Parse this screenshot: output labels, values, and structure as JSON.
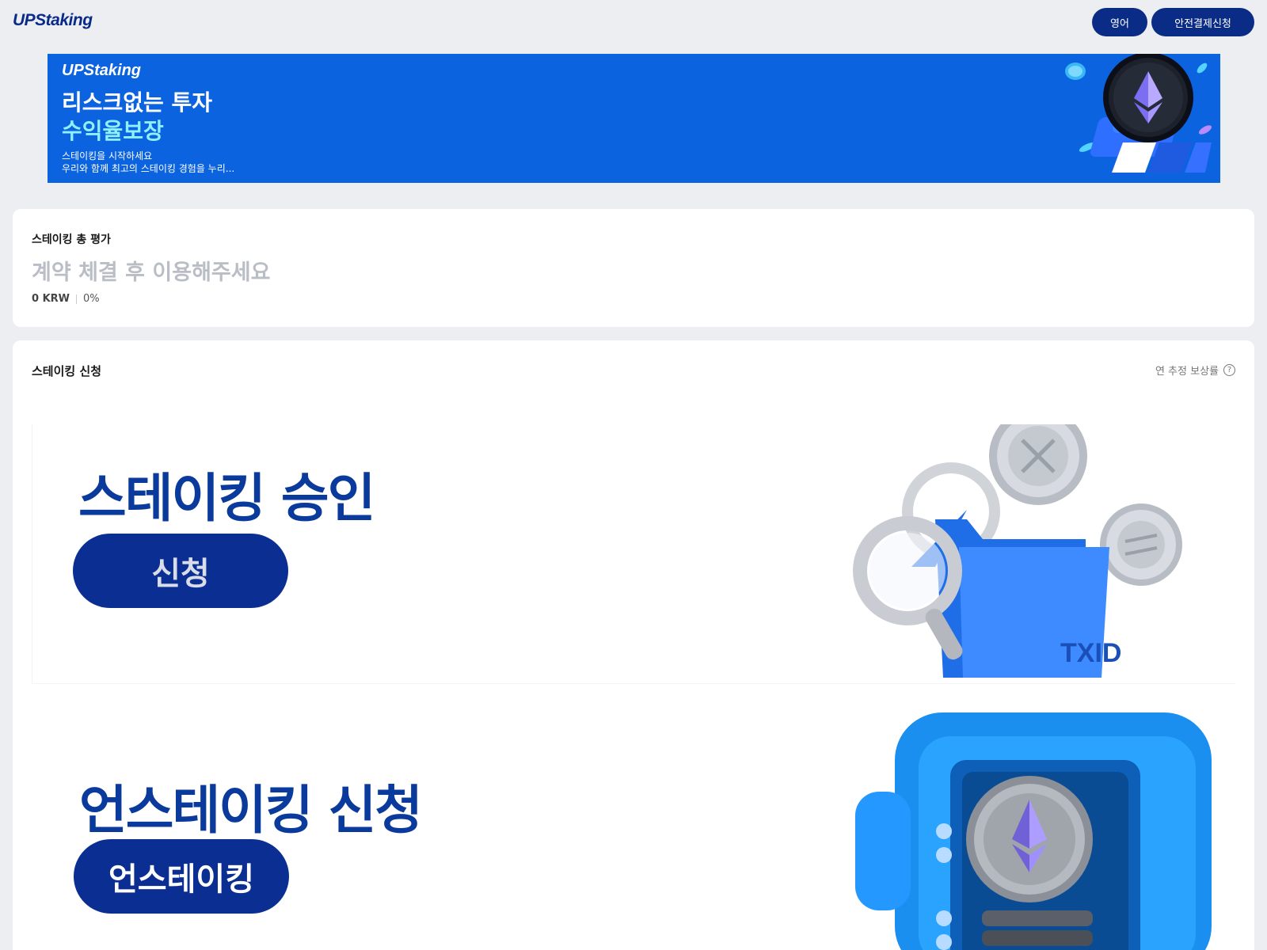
{
  "header": {
    "logo": "UPStaking",
    "lang_label": "영어",
    "payment_label": "안전결제신청"
  },
  "banner": {
    "logo": "UPStaking",
    "headline": "리스크없는 투자",
    "headline_accent": "수익율보장",
    "sub1": "스테이킹을 시작하세요",
    "sub2": "우리와 함께 최고의 스테이킹 경험을 누리...",
    "accent_color": "#8ff0ff",
    "bg_color": "#0b63e0"
  },
  "summary": {
    "title": "스테이킹 총 평가",
    "message": "계약 체결 후 이용해주세요",
    "amount": "0 KRW",
    "percent": "0%"
  },
  "staking": {
    "title": "스테이킹 신청",
    "yield_label": "연 추정 보상률",
    "help_glyph": "?",
    "promos": [
      {
        "title": "스테이킹  승인",
        "button": "신청",
        "art": "magnifier-folder-coins-icon",
        "art_text": "TXID"
      },
      {
        "title": "언스테이킹 신청",
        "button": "언스테이킹",
        "art": "safe-vault-coin-icon"
      }
    ]
  },
  "colors": {
    "primary": "#0b2c86",
    "page_bg": "#eceef2"
  }
}
